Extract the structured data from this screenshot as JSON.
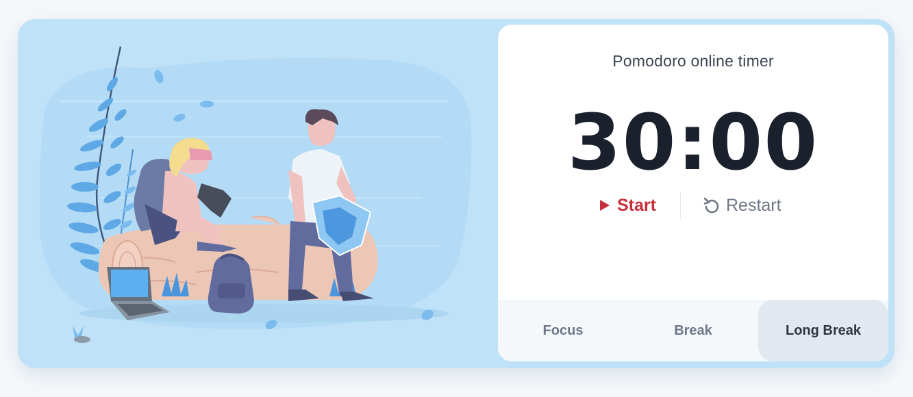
{
  "app": {
    "title": "Pomodoro online timer"
  },
  "timer": {
    "display": "30:00"
  },
  "controls": {
    "start_label": "Start",
    "restart_label": "Restart",
    "start_icon": "play-icon",
    "restart_icon": "restart-icon"
  },
  "tabs": [
    {
      "label": "Focus",
      "active": false
    },
    {
      "label": "Break",
      "active": false
    },
    {
      "label": "Long Break",
      "active": true
    }
  ],
  "colors": {
    "background": "#bfe2f8",
    "accent": "#c6303a",
    "panel": "#ffffff",
    "tab_active": "#e2e8f0"
  }
}
